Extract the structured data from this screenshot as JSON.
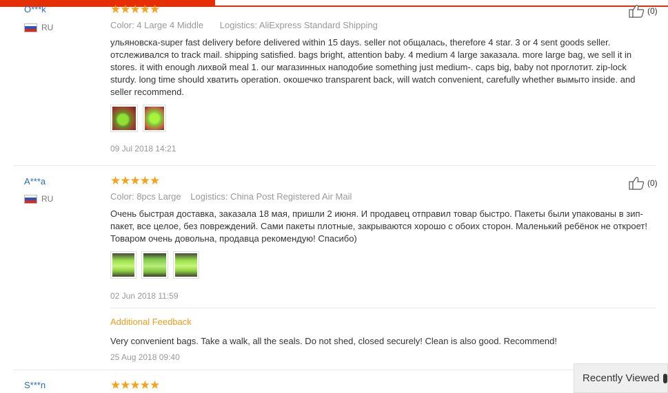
{
  "reviews": [
    {
      "user": "O***k",
      "country": "RU",
      "stars": "★★★★★",
      "color_attr": "Color: 4 Large 4 Middle",
      "logistics": "Logistics: AliExpress Standard Shipping",
      "text": "ульяновска-super fast delivery before delivered within 15 days. seller not общалась, therefore 4 star. 3 or 4 sent goods seller. отслеживался to track mail. shipping satisfied. bags bright, attention baby. 4 medium 4 large заказала. more large bag, we sell it in stores. it with enough лихвой meal 1. our магазинных наподобие something just medium-. caps big, baby not проглотит. zip-lock sturdy. long time should хватить operation. окошечко transparent back, will watch convenient, carefully whether вымыто inside. and seller recommend.",
      "date": "09 Jul 2018 14:21",
      "likes": "(0)"
    },
    {
      "user": "A***a",
      "country": "RU",
      "stars": "★★★★★",
      "color_attr": "Color: 8pcs Large",
      "logistics": "Logistics: China Post Registered Air Mail",
      "text": "Очень быстрая доставка, заказала 18 мая, пришли 2 июня. И продавец отправил товар быстро. Пакеты были упакованы в зип-пакет, все целое, без повреждений. Сами пакеты плотные, закрываются хорошо с обоих сторон. Маленький ребёнок не откроет! Товаром очень довольна, продавца рекомендую! Спасибо)",
      "date": "02 Jun 2018 11:59",
      "likes": "(0)",
      "additional": {
        "title": "Additional Feedback",
        "text": "Very convenient bags. Take a walk, all the seals. Do not shed, closed securely! Clean is also good. Recommend!",
        "date": "25 Aug 2018 09:40"
      }
    },
    {
      "user": "S***n",
      "stars": "★★★★★"
    }
  ],
  "recently_viewed": "Recently Viewed",
  "colors": {
    "accent": "#e62e04",
    "star": "#f7a21b",
    "link": "#2a6bbd",
    "additional": "#f49b1a"
  },
  "icons": [
    "thumbs-up-icon",
    "russia-flag-icon",
    "recently-viewed-icon"
  ]
}
